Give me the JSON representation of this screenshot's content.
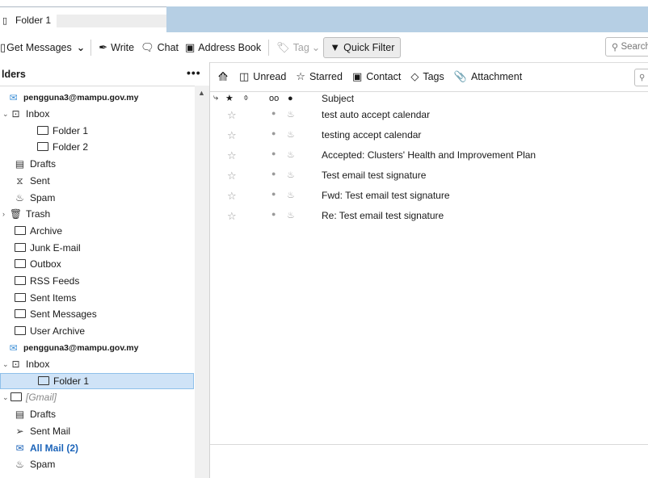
{
  "tab": {
    "title": "Folder 1"
  },
  "toolbar": {
    "get_messages": "Get Messages",
    "write": "Write",
    "chat": "Chat",
    "address_book": "Address Book",
    "tag": "Tag",
    "quick_filter": "Quick Filter",
    "search_placeholder": "Search"
  },
  "folder_pane": {
    "title": "lders",
    "more": "•••",
    "items": [
      {
        "label": "pengguna3@mampu.gov.my",
        "type": "account",
        "icon": "account-icon"
      },
      {
        "label": "Inbox",
        "type": "inbox",
        "icon": "inbox-icon"
      },
      {
        "label": "Folder 1",
        "type": "folder",
        "icon": "folder-icon"
      },
      {
        "label": "Folder 2",
        "type": "folder",
        "icon": "folder-icon"
      },
      {
        "label": "Drafts",
        "type": "drafts",
        "icon": "drafts-icon"
      },
      {
        "label": "Sent",
        "type": "sent",
        "icon": "sent-icon"
      },
      {
        "label": "Spam",
        "type": "spam",
        "icon": "spam-icon"
      },
      {
        "label": "Trash",
        "type": "trash",
        "icon": "trash-icon"
      },
      {
        "label": "Archive",
        "type": "folder",
        "icon": "folder-icon"
      },
      {
        "label": "Junk E-mail",
        "type": "folder",
        "icon": "folder-icon"
      },
      {
        "label": "Outbox",
        "type": "folder",
        "icon": "folder-icon"
      },
      {
        "label": "RSS Feeds",
        "type": "folder",
        "icon": "folder-icon"
      },
      {
        "label": "Sent Items",
        "type": "folder",
        "icon": "folder-icon"
      },
      {
        "label": "Sent Messages",
        "type": "folder",
        "icon": "folder-icon"
      },
      {
        "label": "User Archive",
        "type": "folder",
        "icon": "folder-icon"
      },
      {
        "label": "pengguna3@mampu.gov.my",
        "type": "account",
        "icon": "account-icon"
      },
      {
        "label": "Inbox",
        "type": "inbox",
        "icon": "inbox-icon"
      },
      {
        "label": "Folder 1",
        "type": "folder",
        "icon": "folder-icon",
        "selected": true
      },
      {
        "label": "[Gmail]",
        "type": "folder",
        "icon": "folder-icon",
        "italic": true
      },
      {
        "label": "Drafts",
        "type": "drafts",
        "icon": "drafts-icon"
      },
      {
        "label": "Sent Mail",
        "type": "sent",
        "icon": "sent-mail-icon"
      },
      {
        "label": "All Mail (2)",
        "type": "allmail",
        "icon": "all-mail-icon",
        "bold": true
      },
      {
        "label": "Spam",
        "type": "spam",
        "icon": "spam-icon"
      }
    ]
  },
  "quick_filter_bar": {
    "unread": "Unread",
    "starred": "Starred",
    "contact": "Contact",
    "tags": "Tags",
    "attachment": "Attachment"
  },
  "thread_header": {
    "subject": "Subject"
  },
  "messages": [
    {
      "subject": "test auto accept calendar"
    },
    {
      "subject": "testing accept calendar"
    },
    {
      "subject": "Accepted: Clusters' Health and Improvement Plan"
    },
    {
      "subject": "Test email test signature"
    },
    {
      "subject": "Fwd: Test email test signature"
    },
    {
      "subject": "Re: Test email test signature"
    }
  ]
}
